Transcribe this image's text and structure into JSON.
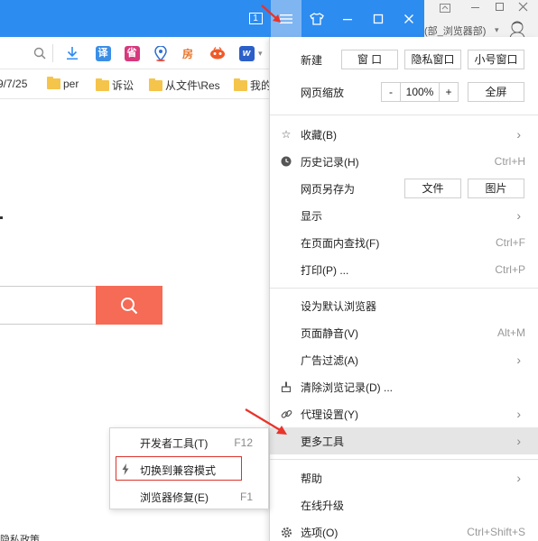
{
  "titlebar": {
    "window_count": "1",
    "icons": [
      "window-count-icon",
      "menu-icon",
      "skin-icon",
      "minimize-icon",
      "maximize-icon",
      "close-icon"
    ]
  },
  "user": {
    "name": "(部_浏览器部)"
  },
  "toolbar": {
    "translate_label": "译",
    "province_label": "省",
    "house_label": "房",
    "word_label": "w",
    "icons": [
      "search-icon",
      "download-icon",
      "translate-icon",
      "province-icon",
      "location-icon",
      "house-icon",
      "game-icon",
      "word-icon"
    ]
  },
  "bookmarks": [
    {
      "label": "9/7/25"
    },
    {
      "label": "per"
    },
    {
      "label": "诉讼"
    },
    {
      "label": "从文件\\Res"
    },
    {
      "label": "我的"
    }
  ],
  "page": {
    "footer_text": "隐私政策"
  },
  "menu": {
    "new_label": "新建",
    "new_window": "窗 口",
    "new_private": "隐私窗口",
    "new_small": "小号窗口",
    "zoom_label": "网页缩放",
    "zoom_minus": "-",
    "zoom_value": "100%",
    "zoom_plus": "+",
    "fullscreen": "全屏",
    "favorites": "收藏(B)",
    "history": "历史记录(H)",
    "history_short": "Ctrl+H",
    "save_as": "网页另存为",
    "save_file": "文件",
    "save_image": "图片",
    "display": "显示",
    "find": "在页面内查找(F)",
    "find_short": "Ctrl+F",
    "print": "打印(P) ...",
    "print_short": "Ctrl+P",
    "default_browser": "设为默认浏览器",
    "mute": "页面静音(V)",
    "mute_short": "Alt+M",
    "adblock": "广告过滤(A)",
    "clear": "清除浏览记录(D) ...",
    "proxy": "代理设置(Y)",
    "more_tools": "更多工具",
    "help": "帮助",
    "upgrade": "在线升级",
    "options": "选项(O)",
    "options_short": "Ctrl+Shift+S"
  },
  "submenu": {
    "devtools": "开发者工具(T)",
    "devtools_short": "F12",
    "compat": "切换到兼容模式",
    "repair": "浏览器修复(E)",
    "repair_short": "F1"
  },
  "colors": {
    "titlebar": "#2d8cf0",
    "search_button": "#f56b56",
    "highlight_box": "#d9342b",
    "annotation_arrow": "#e8342a"
  }
}
